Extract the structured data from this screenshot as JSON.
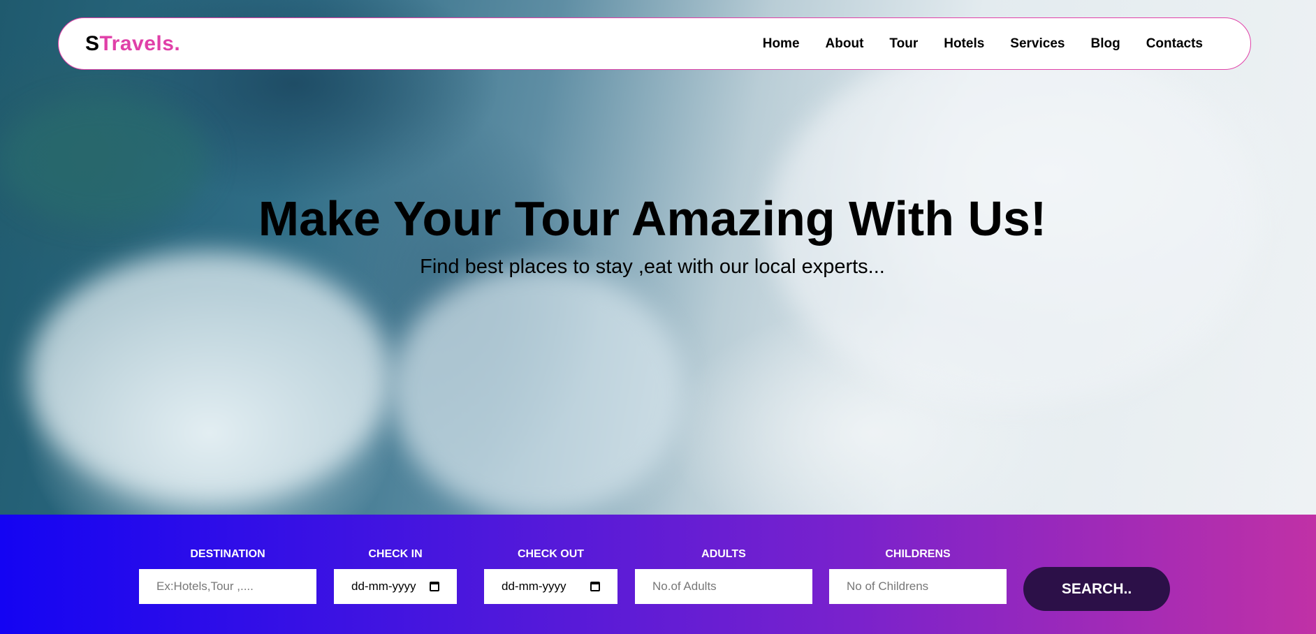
{
  "brand": {
    "logo_first": "S",
    "logo_rest": "Travels."
  },
  "nav": {
    "items": [
      {
        "label": "Home"
      },
      {
        "label": "About"
      },
      {
        "label": "Tour"
      },
      {
        "label": "Hotels"
      },
      {
        "label": "Services"
      },
      {
        "label": "Blog"
      },
      {
        "label": "Contacts"
      }
    ]
  },
  "hero": {
    "title": "Make Your Tour Amazing With Us!",
    "subtitle": "Find best places to stay ,eat with our local experts..."
  },
  "booking": {
    "destination": {
      "label": "DESTINATION",
      "placeholder": "Ex:Hotels,Tour ,...."
    },
    "checkin": {
      "label": "CHECK IN",
      "value": "dd-mm-yyyy"
    },
    "checkout": {
      "label": "CHECK OUT",
      "value": "dd-mm-yyyy"
    },
    "adults": {
      "label": "ADULTS",
      "placeholder": "No.of Adults"
    },
    "children": {
      "label": "CHILDRENS",
      "placeholder": "No of Childrens"
    },
    "search_label": "SEARCH.."
  },
  "colors": {
    "accent": "#e040a8",
    "button": "#2c1048",
    "gradient_start": "#1404f3",
    "gradient_end": "#c031a6"
  }
}
